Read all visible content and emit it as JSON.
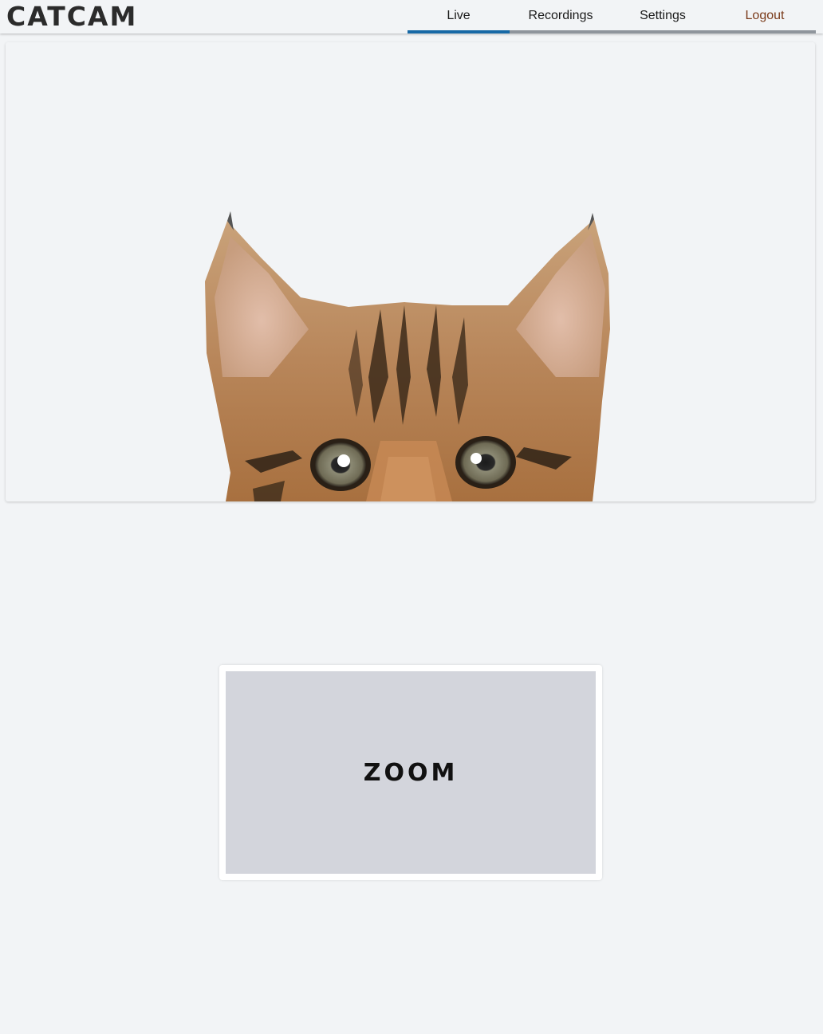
{
  "app": {
    "logo_text": "CATCAM"
  },
  "nav": {
    "tabs": [
      {
        "label": "Live",
        "active": true
      },
      {
        "label": "Recordings",
        "active": false
      },
      {
        "label": "Settings",
        "active": false
      },
      {
        "label": "Logout",
        "active": false
      }
    ]
  },
  "colors": {
    "active_tab": "#1769a6",
    "inactive_tab_underline": "#8f959c",
    "logout_text": "#7a3a1a",
    "background": "#f2f4f6"
  },
  "live_view": {
    "image": "cat-peeking-image"
  },
  "zoom": {
    "label": "ZOOM"
  }
}
